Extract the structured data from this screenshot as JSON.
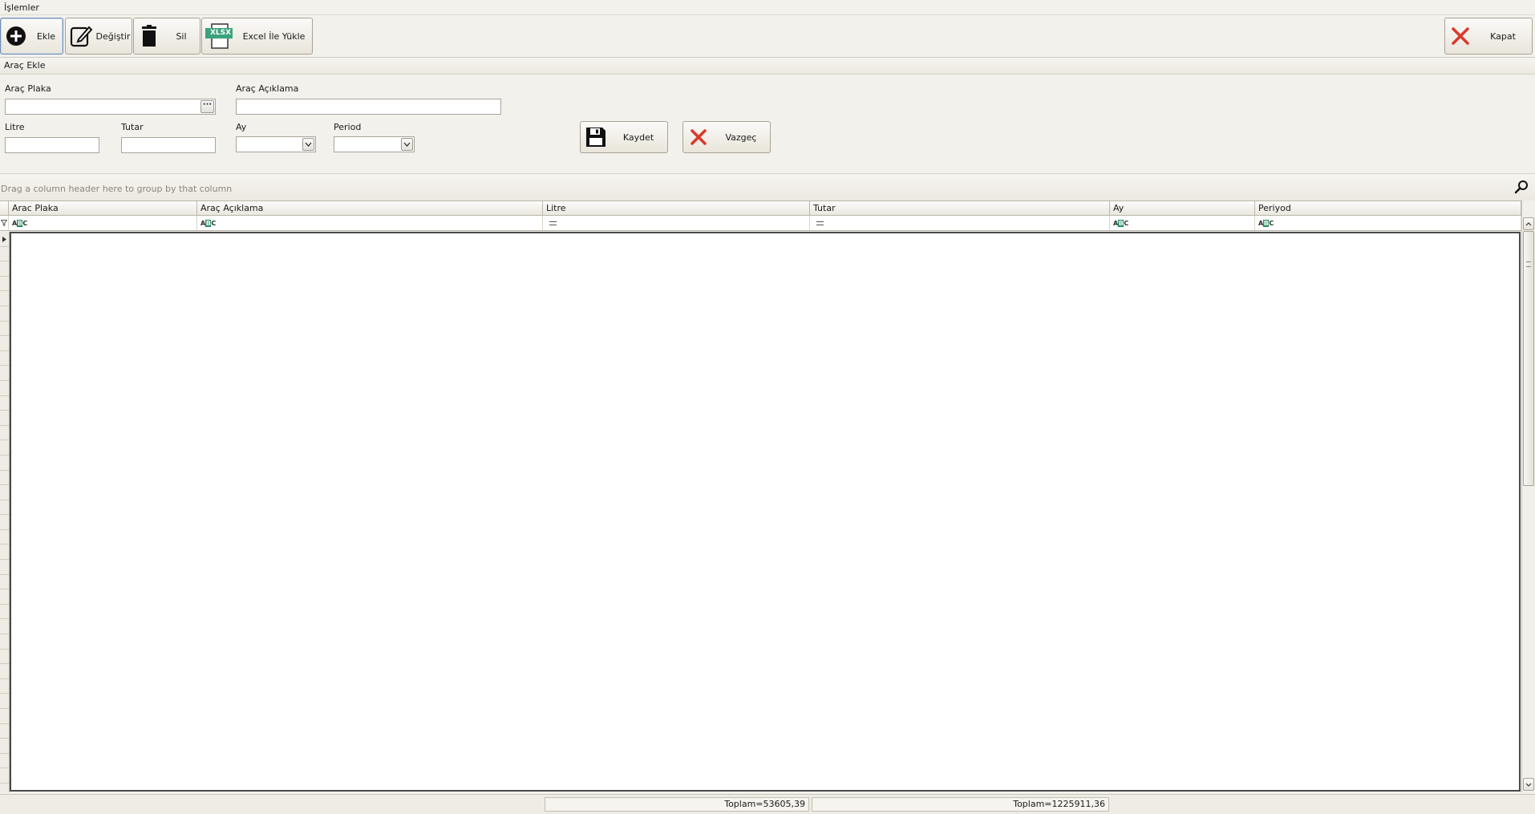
{
  "menu": {
    "title": "İşlemler"
  },
  "toolbar": {
    "add_label": "Ekle",
    "edit_label": "Değiştir",
    "delete_label": "Sil",
    "excel_label": "Excel İle Yükle",
    "excel_badge": "XLSX",
    "close_label": "Kapat"
  },
  "form": {
    "section_title": "Araç Ekle",
    "plate_label": "Araç Plaka",
    "plate_value": "",
    "desc_label": "Araç Açıklama",
    "desc_value": "",
    "liter_label": "Litre",
    "liter_value": "",
    "amount_label": "Tutar",
    "amount_value": "",
    "month_label": "Ay",
    "month_value": "",
    "period_label": "Period",
    "period_value": "",
    "save_label": "Kaydet",
    "cancel_label": "Vazgeç"
  },
  "grid": {
    "group_hint": "Drag a column header here to group by that column",
    "columns": [
      {
        "label": "Arac Plaka"
      },
      {
        "label": "Araç Açıklama"
      },
      {
        "label": "Litre"
      },
      {
        "label": "Tutar"
      },
      {
        "label": "Ay"
      },
      {
        "label": "Periyod"
      }
    ],
    "rows": [],
    "totals": {
      "litre": "Toplam=53605,39",
      "tutar": "Toplam=1225911,36"
    }
  },
  "colors": {
    "background": "#f3f1ec",
    "danger": "#d9382b",
    "excel_green": "#3aa37b",
    "grid_border": "#4a4a4a"
  },
  "icons": [
    "plus-circle-icon",
    "edit-icon",
    "trash-icon",
    "excel-icon",
    "close-icon",
    "save-icon",
    "search-icon",
    "filter-icon"
  ]
}
